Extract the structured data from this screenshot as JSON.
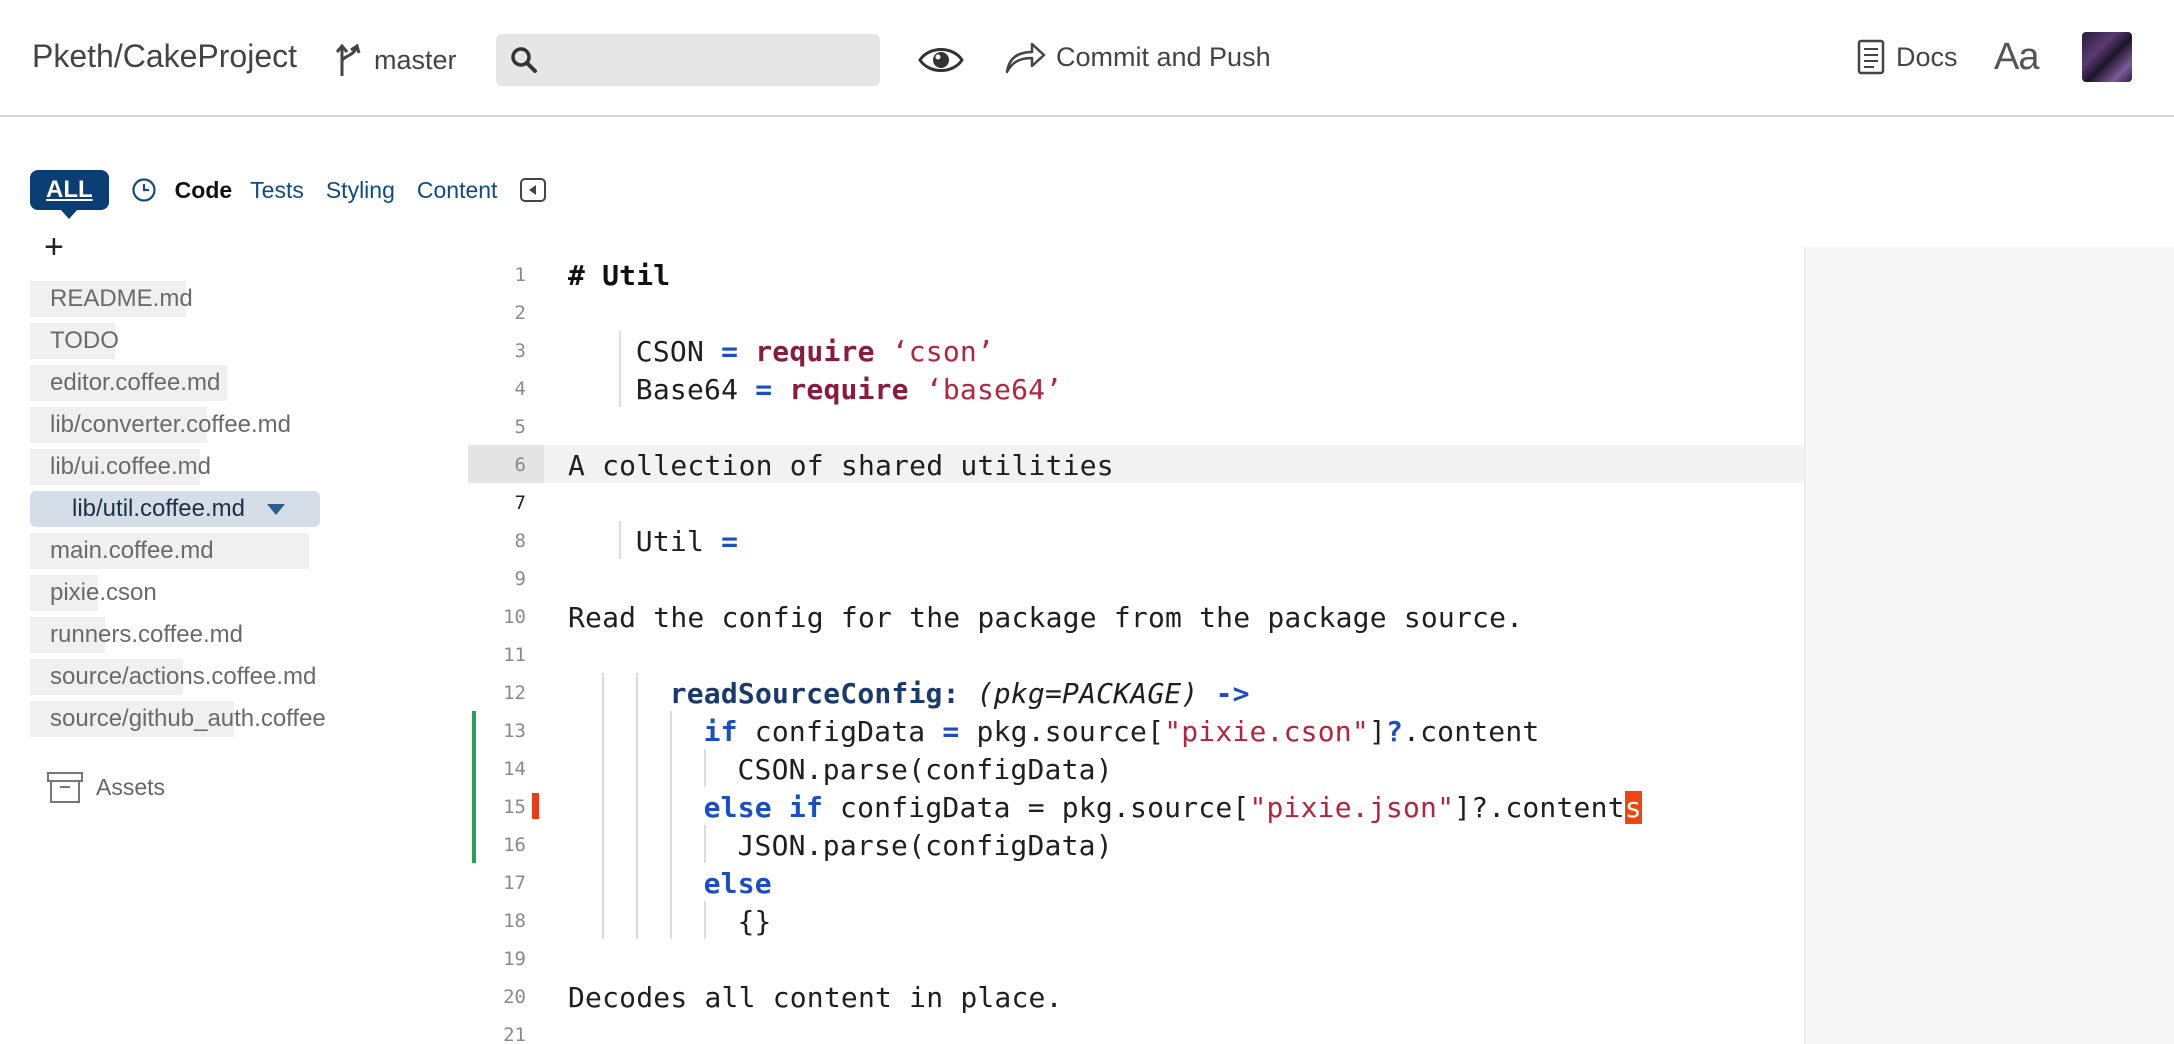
{
  "header": {
    "repo": "Pketh/CakeProject",
    "branch": "master",
    "search_placeholder": "",
    "commit_label": "Commit and Push",
    "docs_label": "Docs",
    "font_toggle": "Aa"
  },
  "filters": {
    "all_label": "ALL",
    "tabs": [
      "Code",
      "Tests",
      "Styling",
      "Content"
    ],
    "active_tab": "Code"
  },
  "sidebar": {
    "add_label": "+",
    "files": [
      {
        "name": "README.md",
        "bar": 0.46
      },
      {
        "name": "TODO",
        "bar": 0.25
      },
      {
        "name": "editor.coffee.md",
        "bar": 0.58
      },
      {
        "name": "lib/converter.coffee.md",
        "bar": 0.52
      },
      {
        "name": "lib/ui.coffee.md",
        "bar": 0.5
      },
      {
        "name": "lib/util.coffee.md",
        "bar": 0.8,
        "active": true
      },
      {
        "name": "main.coffee.md",
        "bar": 0.82
      },
      {
        "name": "pixie.cson",
        "bar": 0.2
      },
      {
        "name": "runners.coffee.md",
        "bar": 0.22
      },
      {
        "name": "source/actions.coffee.md",
        "bar": 0.45
      },
      {
        "name": "source/github_auth.coffee",
        "bar": 0.6
      }
    ],
    "assets_label": "Assets"
  },
  "editor": {
    "current_line": 7,
    "highlight_line": 6,
    "lines": [
      {
        "n": "1",
        "code": "# Util"
      },
      {
        "n": "2",
        "code": ""
      },
      {
        "n": "3",
        "code": "CSON = require ‘cson’"
      },
      {
        "n": "4",
        "code": "Base64 = require ‘base64’"
      },
      {
        "n": "5",
        "code": ""
      },
      {
        "n": "6",
        "code": "A collection of shared utilities"
      },
      {
        "n": "7",
        "code": ""
      },
      {
        "n": "8",
        "code": "Util ="
      },
      {
        "n": "9",
        "code": ""
      },
      {
        "n": "10",
        "code": "Read the config for the package from the package source."
      },
      {
        "n": "11",
        "code": ""
      },
      {
        "n": "12",
        "code": "readSourceConfig: (pkg=PACKAGE) ->"
      },
      {
        "n": "13",
        "code": "if configData = pkg.source[\"pixie.cson\"]?.content"
      },
      {
        "n": "14",
        "code": "CSON.parse(configData)"
      },
      {
        "n": "15",
        "code": "else if configData = pkg.source[\"pixie.json\"]?.contents"
      },
      {
        "n": "16",
        "code": "JSON.parse(configData)"
      },
      {
        "n": "17",
        "code": "else"
      },
      {
        "n": "18",
        "code": "{}"
      },
      {
        "n": "19",
        "code": ""
      },
      {
        "n": "20",
        "code": "Decodes all content in place."
      },
      {
        "n": "21",
        "code": ""
      }
    ]
  },
  "colors": {
    "accent": "#0b3e74",
    "keyword": "#1a4fc4",
    "string": "#b4243f",
    "git_added": "#26a05a",
    "error": "#ea3a17"
  }
}
